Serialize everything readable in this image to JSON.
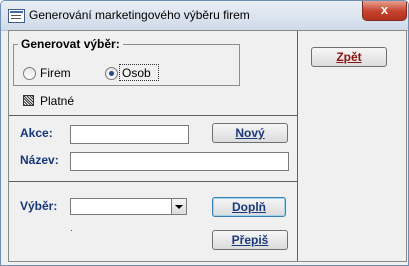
{
  "window": {
    "title": "Generování marketingového výběru firem",
    "close_glyph": "x"
  },
  "generate_group": {
    "title": "Generovat výběr:",
    "options": [
      {
        "label": "Firem",
        "selected": false
      },
      {
        "label": "Osob",
        "selected": true
      }
    ]
  },
  "checkbox": {
    "label": "Platné",
    "state": "indeterminate"
  },
  "fields": {
    "akce_label": "Akce:",
    "akce_value": "",
    "nazev_label": "Název:",
    "nazev_value": "",
    "vyber_label": "Výběr:",
    "vyber_value": ""
  },
  "buttons": {
    "novy": "Nový",
    "dopln": "Doplň",
    "prepis": "Přepiš",
    "zpet": "Zpět"
  }
}
